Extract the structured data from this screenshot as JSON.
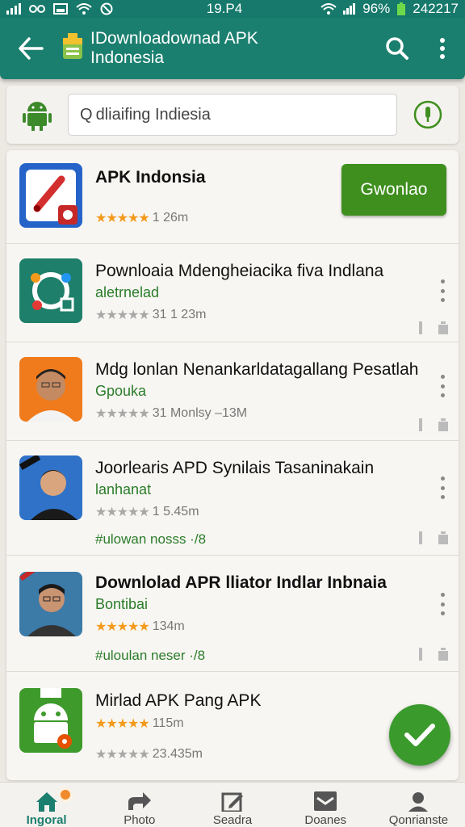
{
  "status_bar": {
    "time": "19.P4",
    "battery": "96%",
    "clock_right": "242217"
  },
  "app_bar": {
    "title": "IDownloadownad APK Indonesia",
    "icons": [
      "back-arrow-icon",
      "app-logo-icon",
      "search-icon",
      "more-vertical-icon"
    ]
  },
  "search": {
    "value": "dliaifing Indiesia"
  },
  "featured": {
    "name": "APK Indonsia",
    "rating_stars": 5,
    "meta": "1 26m",
    "button_label": "Gwonlao"
  },
  "items": [
    {
      "name": "Pownloaia Mdengheiacika fiva Indlana",
      "sub": "aletrnelad",
      "meta": "31 1 23m"
    },
    {
      "name": "Mdg lonlan Nenankarldatagallang Pesatlah",
      "sub": "Gpouka",
      "meta": "31 Monlsy –13M"
    },
    {
      "name": "Joorlearis APD Synilais Tasaninakain",
      "sub": "lanhanat",
      "meta": "1 5.45m",
      "extra": "#ulowan nosss ·/8"
    },
    {
      "name": "Downlolad APR lliator Indlar Inbnaia",
      "sub": "Bontibai",
      "meta": "134m",
      "extra": "#uloulan neser ·/8"
    },
    {
      "name": "Mirlad APK Pang APK",
      "meta": "115m",
      "meta2": "23.435m"
    }
  ],
  "bottom_nav": [
    {
      "label": "Ingoral",
      "icon": "home-icon",
      "active": true
    },
    {
      "label": "Photo",
      "icon": "share-icon",
      "active": false
    },
    {
      "label": "Seadra",
      "icon": "edit-icon",
      "active": false
    },
    {
      "label": "Doanes",
      "icon": "inbox-icon",
      "active": false
    },
    {
      "label": "Qonrianste",
      "icon": "profile-icon",
      "active": false
    }
  ],
  "colors": {
    "primary": "#1b7f6f",
    "accent_green": "#3f8f1f",
    "star_orange": "#f39a1c"
  }
}
